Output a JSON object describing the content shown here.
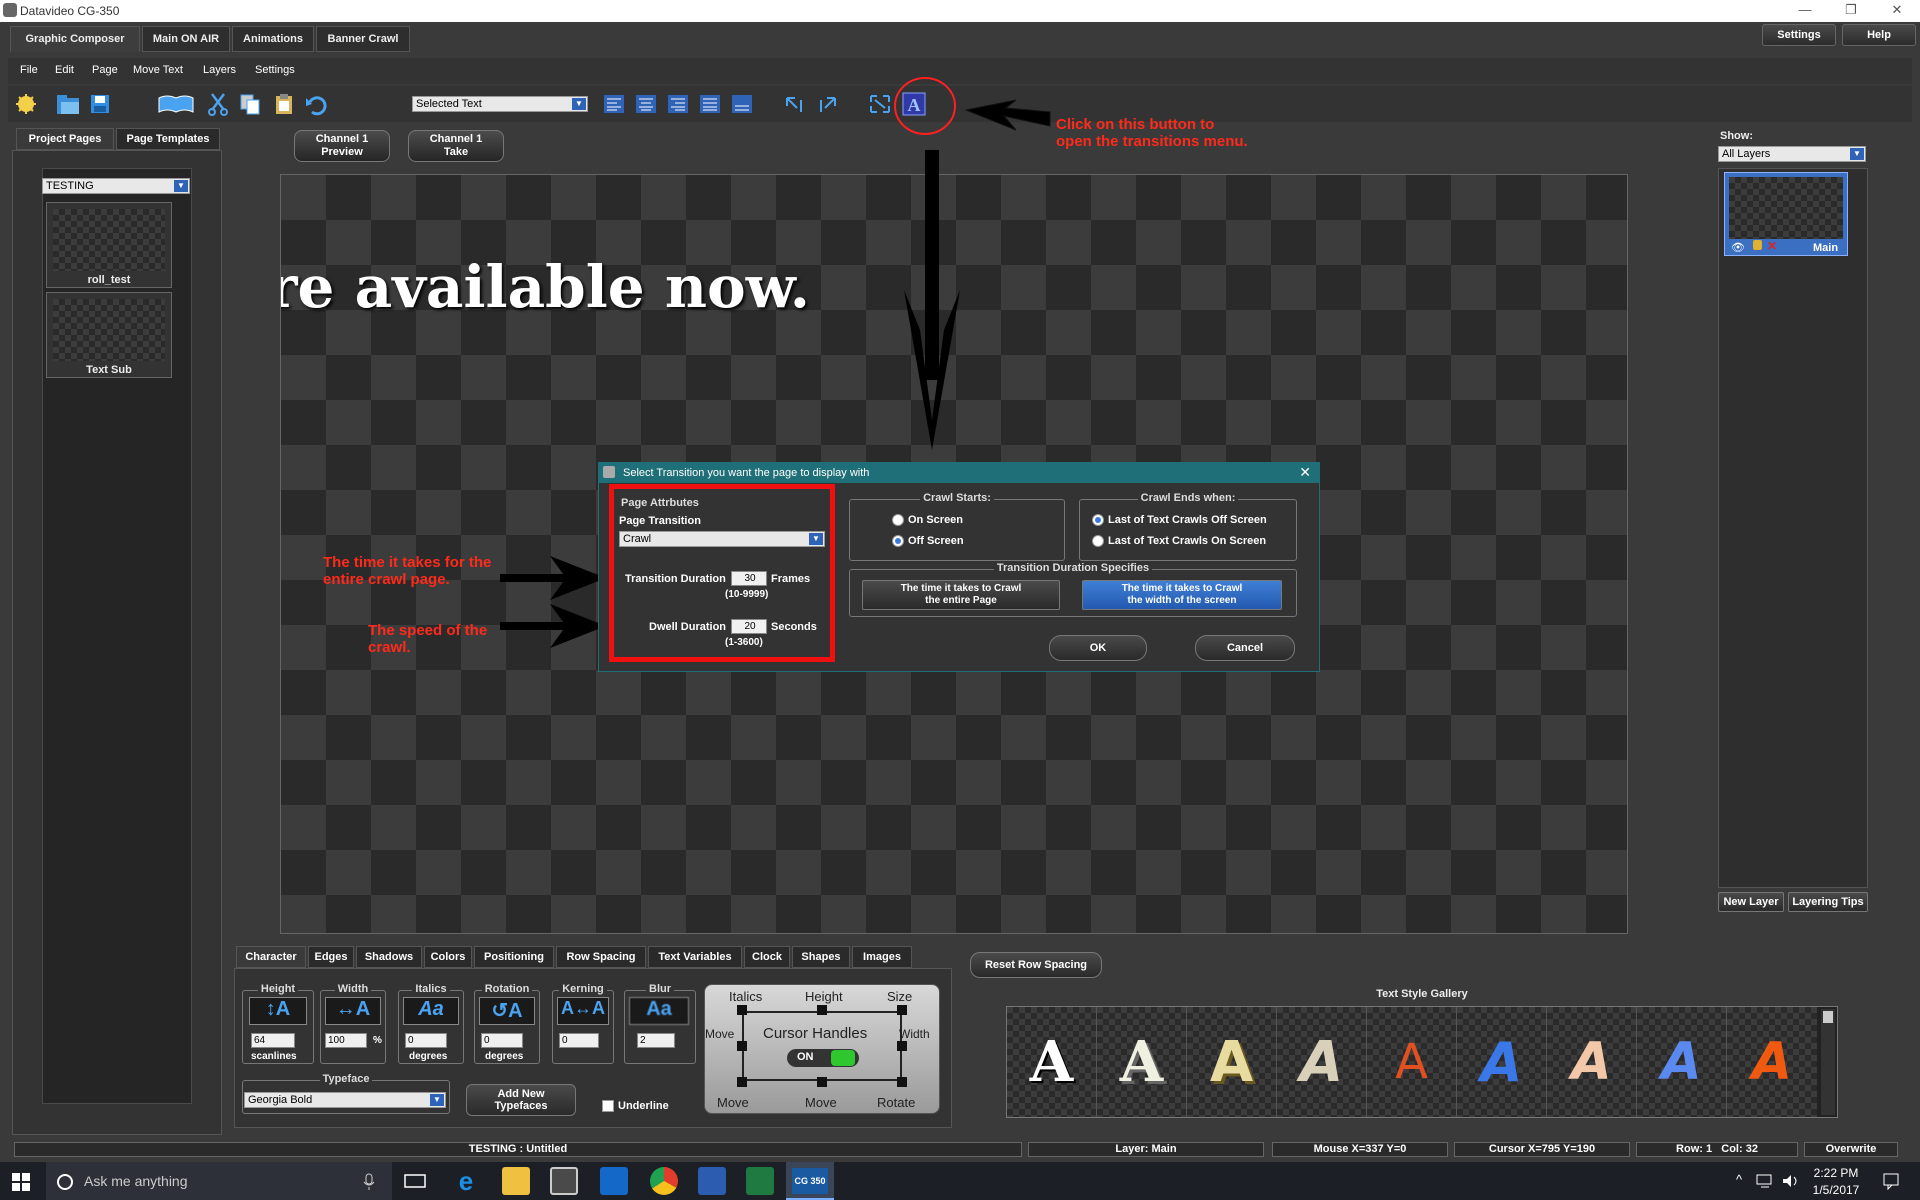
{
  "window": {
    "title": "Datavideo CG-350",
    "minimize": "—",
    "restore": "❐",
    "close": "✕"
  },
  "tabs": [
    "Graphic Composer",
    "Main ON AIR",
    "Animations",
    "Banner Crawl"
  ],
  "top_right": {
    "settings": "Settings",
    "help": "Help"
  },
  "menu": [
    "File",
    "Edit",
    "Page",
    "Move Text",
    "Layers",
    "Settings"
  ],
  "toolbar": {
    "selected_text": "Selected Text"
  },
  "left_panel": {
    "tabs": [
      "Project Pages",
      "Page Templates"
    ],
    "project": "TESTING",
    "pages": [
      "roll_test",
      "Text Sub"
    ]
  },
  "channel": {
    "preview": [
      "Channel 1",
      "Preview"
    ],
    "take": [
      "Channel 1",
      "Take"
    ]
  },
  "canvas_text": "re available now.",
  "annotations": {
    "button_note": [
      "Click on this button to",
      "open the transitions menu."
    ],
    "duration_note": [
      "The time it takes for the",
      "entire crawl page."
    ],
    "speed_note": [
      "The speed of the",
      "crawl."
    ]
  },
  "dialog": {
    "title": "Select Transition you want the page to display with",
    "close": "✕",
    "page_attributes": "Page Attrbutes",
    "page_transition_label": "Page Transition",
    "page_transition_value": "Crawl",
    "transition_duration_label": "Transition Duration",
    "transition_duration_value": "30",
    "transition_duration_unit": "Frames",
    "transition_duration_range": "(10-9999)",
    "dwell_duration_label": "Dwell Duration",
    "dwell_duration_value": "20",
    "dwell_duration_unit": "Seconds",
    "dwell_duration_range": "(1-3600)",
    "crawl_starts": "Crawl Starts:",
    "on_screen": "On Screen",
    "off_screen": "Off Screen",
    "crawl_ends": "Crawl Ends when:",
    "last_off": "Last of Text Crawls Off Screen",
    "last_on": "Last of Text Crawls On Screen",
    "duration_specifies": "Transition Duration Specifies",
    "opt_page": [
      "The time it takes to Crawl",
      "the entire Page"
    ],
    "opt_width": [
      "The time it takes to Crawl",
      "the width of the screen"
    ],
    "ok": "OK",
    "cancel": "Cancel"
  },
  "right_panel": {
    "show_label": "Show:",
    "show_value": "All Layers",
    "layer_name": "Main",
    "new_layer": "New Layer",
    "layering_tips": "Layering Tips"
  },
  "bottom_tabs": [
    "Character",
    "Edges",
    "Shadows",
    "Colors",
    "Positioning",
    "Row Spacing",
    "Text Variables",
    "Clock",
    "Shapes",
    "Images"
  ],
  "character": {
    "height": {
      "label": "Height",
      "value": "64",
      "unit": "scanlines"
    },
    "width": {
      "label": "Width",
      "value": "100",
      "unit": "%"
    },
    "italics": {
      "label": "Italics",
      "value": "0",
      "unit": "degrees"
    },
    "rotation": {
      "label": "Rotation",
      "value": "0",
      "unit": "degrees"
    },
    "kerning": {
      "label": "Kerning",
      "value": "0"
    },
    "blur": {
      "label": "Blur",
      "value": "2"
    },
    "typeface_label": "Typeface",
    "typeface_value": "Georgia Bold",
    "add_typefaces": [
      "Add New",
      "Typefaces"
    ],
    "underline": "Underline"
  },
  "cursor_handles": {
    "title": "Cursor Handles",
    "toggle": "ON",
    "italics": "Italics",
    "height": "Height",
    "size": "Size",
    "move_left": "Move",
    "width": "Width",
    "move_bl": "Move",
    "move_b": "Move",
    "rotate": "Rotate"
  },
  "reset_row_spacing": "Reset Row Spacing",
  "gallery_title": "Text Style Gallery",
  "status": {
    "page": "TESTING : Untitled",
    "layer": "Layer: Main",
    "mouse": "Mouse X=337 Y=0",
    "cursor": "Cursor X=795 Y=190",
    "row": "Row: 1",
    "col": "Col: 32",
    "mode": "Overwrite"
  },
  "taskbar": {
    "search": "Ask me anything",
    "time": "2:22 PM",
    "date": "1/5/2017",
    "cg_label": "CG 350"
  },
  "colors": {
    "annotation_red": "#ff2a1a",
    "accent_blue": "#2f63b8",
    "dialog_teal": "#1f6f78"
  }
}
